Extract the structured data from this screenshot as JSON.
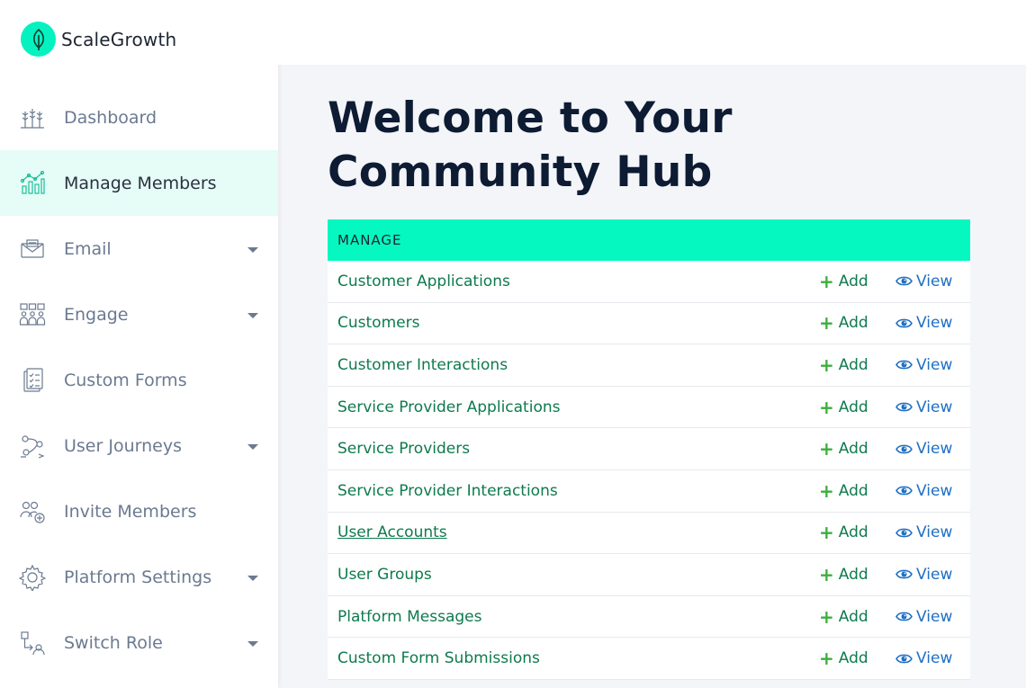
{
  "brand": {
    "name": "ScaleGrowth",
    "logo_icon": "leaf-icon",
    "accent": "#05f2c0"
  },
  "sidebar": {
    "items": [
      {
        "label": "Dashboard",
        "icon": "wheat-icon",
        "dropdown": false,
        "active": false
      },
      {
        "label": "Manage Members",
        "icon": "bar-chart-icon",
        "dropdown": false,
        "active": true
      },
      {
        "label": "Email",
        "icon": "envelope-icon",
        "dropdown": true,
        "active": false
      },
      {
        "label": "Engage",
        "icon": "group-icon",
        "dropdown": true,
        "active": false
      },
      {
        "label": "Custom Forms",
        "icon": "clipboard-icon",
        "dropdown": false,
        "active": false
      },
      {
        "label": "User Journeys",
        "icon": "journey-icon",
        "dropdown": true,
        "active": false
      },
      {
        "label": "Invite Members",
        "icon": "user-add-icon",
        "dropdown": false,
        "active": false
      },
      {
        "label": "Platform Settings",
        "icon": "gear-icon",
        "dropdown": true,
        "active": false
      },
      {
        "label": "Switch Role",
        "icon": "switch-role-icon",
        "dropdown": true,
        "active": false
      }
    ]
  },
  "main": {
    "title": "Welcome to Your Community Hub",
    "table": {
      "header": "MANAGE",
      "header_color": "#05f8c0",
      "add_label": "Add",
      "view_label": "View",
      "rows": [
        {
          "label": "Customer Applications",
          "underlined": false
        },
        {
          "label": "Customers",
          "underlined": false
        },
        {
          "label": "Customer Interactions",
          "underlined": false
        },
        {
          "label": "Service Provider Applications",
          "underlined": false
        },
        {
          "label": "Service Providers",
          "underlined": false
        },
        {
          "label": "Service Provider Interactions",
          "underlined": false
        },
        {
          "label": "User Accounts",
          "underlined": true
        },
        {
          "label": "User Groups",
          "underlined": false
        },
        {
          "label": "Platform Messages",
          "underlined": false
        },
        {
          "label": "Custom Form Submissions",
          "underlined": false
        }
      ]
    }
  }
}
